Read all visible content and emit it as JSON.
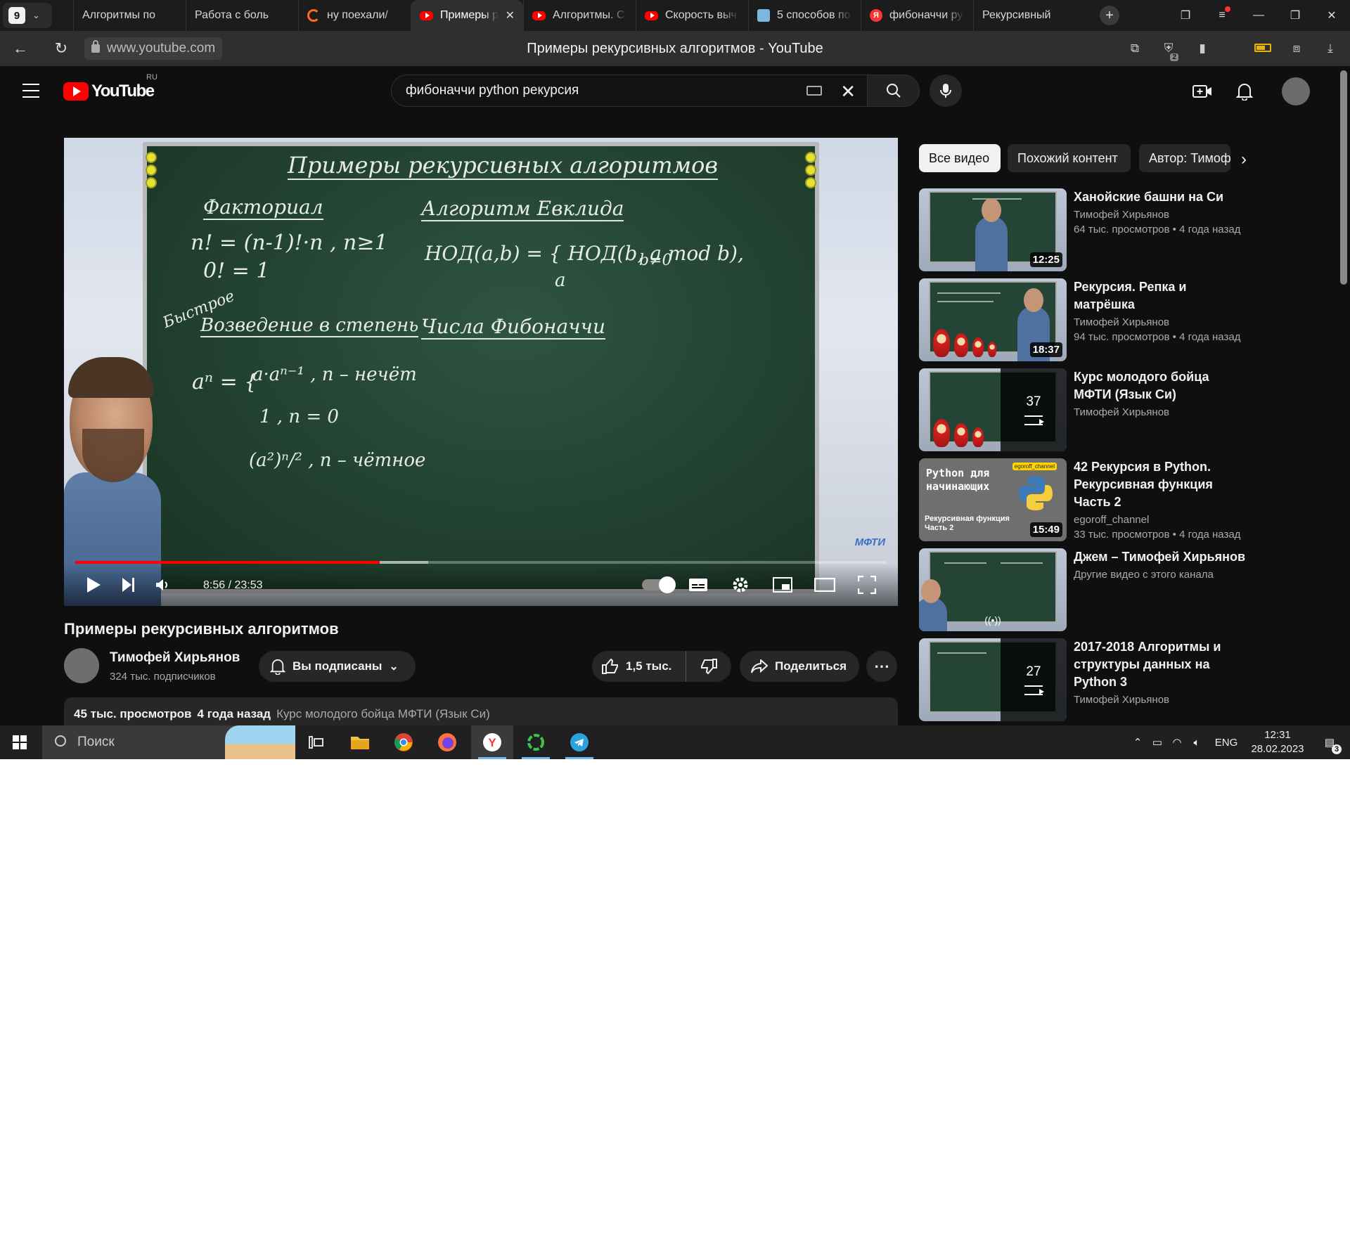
{
  "browser": {
    "tab_count": "9",
    "tabs": [
      {
        "label": "Алгоритмы по",
        "icon": "person-favicon"
      },
      {
        "label": "Работа с боль",
        "icon": "person-favicon"
      },
      {
        "label": "ну поехали/",
        "icon": "spinner-favicon"
      },
      {
        "label": "Примеры р",
        "icon": "youtube-favicon",
        "active": true
      },
      {
        "label": "Алгоритмы. С",
        "icon": "youtube-favicon"
      },
      {
        "label": "Скорость выч",
        "icon": "youtube-favicon"
      },
      {
        "label": "5 способов по",
        "icon": "star-favicon"
      },
      {
        "label": "фибоначчи ру",
        "icon": "yandex-favicon"
      },
      {
        "label": "Рекурсивный",
        "icon": "person-favicon"
      }
    ],
    "url": "www.youtube.com",
    "page_title": "Примеры рекурсивных алгоритмов - YouTube",
    "bookmark_badge": "2"
  },
  "youtube": {
    "logo_text": "YouTube",
    "logo_country": "RU",
    "search_value": "фибоначчи python рекурсия",
    "video": {
      "title": "Примеры рекурсивных алгоритмов",
      "time_current": "8:56",
      "time_total": "23:53",
      "progress": 0.375,
      "buffered": 0.435,
      "watermark": "МФТИ",
      "board": {
        "heading": "Примеры рекурсивных алгоритмов",
        "factorial_title": "Факториал",
        "factorial_line1": "n! = (n-1)!·n , n≥1",
        "factorial_line2": "0! = 1",
        "euclid_title": "Алгоритм Евклида",
        "euclid_line1": "НОД(a,b) = { НОД(b, a mod b),",
        "euclid_line2": "a",
        "euclid_cond": "b≠0",
        "power_note": "Быстрое",
        "power_title": "Возведение в степень",
        "power_eq": "aⁿ = {",
        "power_case1": "a·aⁿ⁻¹ , n – нечёт",
        "power_case2": "1 , n = 0",
        "power_case3": "(a²)ⁿ/² , n – чётное",
        "fib_title": "Числа Фибоначчи"
      }
    },
    "channel": {
      "name": "Тимофей Хирьянов",
      "subscribers": "324 тыс. подписчиков",
      "subscribe_label": "Вы подписаны"
    },
    "actions": {
      "likes": "1,5 тыс.",
      "share": "Поделиться"
    },
    "description": {
      "views": "45 тыс. просмотров",
      "date": "4 года назад",
      "playlist": "Курс молодого бойца МФТИ (Язык Си)"
    },
    "chips": [
      "Все видео",
      "Похожий контент",
      "Автор: Тимофей Хирьянов"
    ],
    "recommendations": [
      {
        "title": "Ханойские башни на Си",
        "channel": "Тимофей Хирьянов",
        "meta": "64 тыс. просмотров • 4 года назад",
        "duration": "12:25"
      },
      {
        "title": "Рекурсия. Репка и матрёшка",
        "channel": "Тимофей Хирьянов",
        "meta": "94 тыс. просмотров • 4 года назад",
        "duration": "18:37"
      },
      {
        "title": "Курс молодого бойца МФТИ (Язык Си)",
        "channel": "Тимофей Хирьянов",
        "meta": "",
        "playlist_count": "37"
      },
      {
        "title": "42 Рекурсия в Python. Рекурсивная функция Часть 2",
        "channel": "egoroff_channel",
        "meta": "33 тыс. просмотров • 4 года назад",
        "duration": "15:49",
        "thumb_title": "Python для начинающих",
        "thumb_sub": "Рекурсивная функция Часть 2",
        "thumb_tag": "egoroff_channel"
      },
      {
        "title": "Джем – Тимофей Хирьянов",
        "channel": "Другие видео с этого канала",
        "meta": ""
      },
      {
        "title": "2017-2018 Алгоритмы и структуры данных на Python 3",
        "channel": "Тимофей Хирьянов",
        "meta": "",
        "playlist_count": "27"
      }
    ]
  },
  "taskbar": {
    "search_placeholder": "Поиск",
    "language": "ENG",
    "time": "12:31",
    "date": "28.02.2023",
    "notifications": "3"
  },
  "colors": {
    "accent_red": "#ff0000",
    "background": "#0f0f0f",
    "chip_active": "#f1f1f1"
  }
}
